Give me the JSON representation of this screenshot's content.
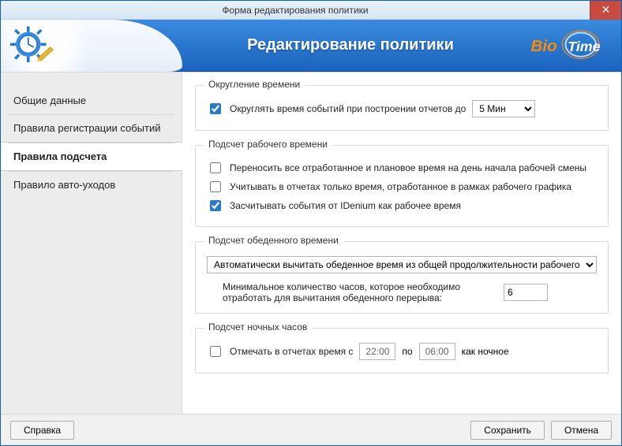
{
  "window": {
    "title": "Форма редактирования политики"
  },
  "banner": {
    "heading": "Редактирование политики",
    "logo_text_1": "Bio",
    "logo_text_2": "Time"
  },
  "sidebar": {
    "items": [
      {
        "label": "Общие данные"
      },
      {
        "label": "Правила регистрации событий"
      },
      {
        "label": "Правила подсчета"
      },
      {
        "label": "Правило авто-уходов"
      }
    ],
    "active_index": 2
  },
  "rounding": {
    "group_title": "Округление времени",
    "cb_label": "Округлять время событий при построении отчетов до",
    "cb_checked": true,
    "select_value": "5 Мин",
    "select_options": [
      "5 Мин"
    ]
  },
  "worktime": {
    "group_title": "Подсчет рабочего времени",
    "items": [
      {
        "label": "Переносить все отработанное и плановое время на день начала рабочей смены",
        "checked": false
      },
      {
        "label": "Учитывать в отчетах только время, отработанное в рамках рабочего графика",
        "checked": false
      },
      {
        "label": "Засчитывать события от IDenium как рабочее время",
        "checked": true
      }
    ]
  },
  "lunch": {
    "group_title": "Подсчет обеденного времени",
    "select_value": "Автоматически вычитать обеденное время из общей продолжительности рабочего дня",
    "hours_label": "Минимальное количество часов, которое необходимо отработать для вычитания обеденного перерыва:",
    "hours_value": "6"
  },
  "night": {
    "group_title": "Подсчет ночных часов",
    "cb_label_pre": "Отмечать в отчетах время с",
    "from": "22:00",
    "mid": "по",
    "to": "06:00",
    "post": "как ночное",
    "cb_checked": false
  },
  "footer": {
    "help": "Справка",
    "save": "Сохранить",
    "cancel": "Отмена"
  }
}
